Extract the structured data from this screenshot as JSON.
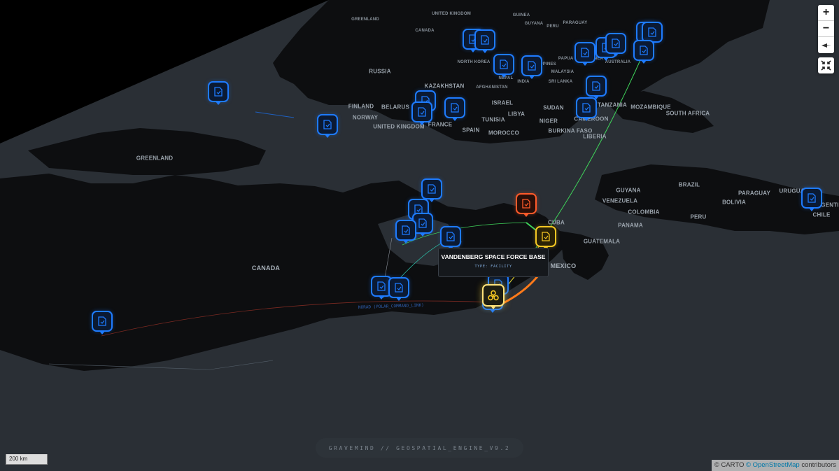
{
  "map": {
    "colors": {
      "sky": "#000000",
      "ocean": "#2a2f35",
      "land": "#0d0e10",
      "pin_blue": "#1e7bff",
      "pin_red": "#ff5a2a",
      "pin_yellow": "#f3c623",
      "route_orange": "#ff7a1a",
      "route_green": "#3fd25a"
    },
    "labels": [
      {
        "text": "GREENLAND",
        "size": "sm"
      },
      {
        "text": "UNITED KINGDOM",
        "size": "sm"
      },
      {
        "text": "GUINEA",
        "size": "sm"
      },
      {
        "text": "GUYANA",
        "size": "sm"
      },
      {
        "text": "PERU",
        "size": "sm"
      },
      {
        "text": "PARAGUAY",
        "size": "sm"
      },
      {
        "text": "CANADA",
        "size": "sm"
      },
      {
        "text": "PAPUA NEW GUINEA",
        "size": "sm"
      },
      {
        "text": "AUSTRALIA",
        "size": "sm"
      },
      {
        "text": "NORTH KOREA",
        "size": "sm"
      },
      {
        "text": "RUSSIA",
        "size": "md"
      },
      {
        "text": "NEPAL",
        "size": "sm"
      },
      {
        "text": "INDIA",
        "size": "sm"
      },
      {
        "text": "MALAYSIA",
        "size": "sm"
      },
      {
        "text": "SRI LANKA",
        "size": "sm"
      },
      {
        "text": "PHILIPPINES",
        "size": "sm"
      },
      {
        "text": "KAZAKHSTAN",
        "size": "md"
      },
      {
        "text": "AFGHANISTAN",
        "size": "sm"
      },
      {
        "text": "FINLAND",
        "size": "md"
      },
      {
        "text": "NORWAY",
        "size": "md"
      },
      {
        "text": "BELARUS",
        "size": "md"
      },
      {
        "text": "ISRAEL",
        "size": "md"
      },
      {
        "text": "LIBYA",
        "size": "md"
      },
      {
        "text": "SUDAN",
        "size": "md"
      },
      {
        "text": "TANZANIA",
        "size": "md"
      },
      {
        "text": "MOZAMBIQUE",
        "size": "md"
      },
      {
        "text": "SOUTH AFRICA",
        "size": "md"
      },
      {
        "text": "UNITED KINGDOM",
        "size": "md"
      },
      {
        "text": "FRANCE",
        "size": "md"
      },
      {
        "text": "TUNISIA",
        "size": "md"
      },
      {
        "text": "NIGER",
        "size": "md"
      },
      {
        "text": "CAMEROON",
        "size": "md"
      },
      {
        "text": "SPAIN",
        "size": "md"
      },
      {
        "text": "MOROCCO",
        "size": "md"
      },
      {
        "text": "BURKINA FASO",
        "size": "md"
      },
      {
        "text": "LIBERIA",
        "size": "md"
      },
      {
        "text": "GREENLAND",
        "size": "md"
      },
      {
        "text": "GUYANA",
        "size": "md"
      },
      {
        "text": "BRAZIL",
        "size": "md"
      },
      {
        "text": "VENEZUELA",
        "size": "md"
      },
      {
        "text": "PARAGUAY",
        "size": "md"
      },
      {
        "text": "URUGUAY",
        "size": "md"
      },
      {
        "text": "COLOMBIA",
        "size": "md"
      },
      {
        "text": "BOLIVIA",
        "size": "md"
      },
      {
        "text": "PERU",
        "size": "md"
      },
      {
        "text": "ARGENTINA",
        "size": "md"
      },
      {
        "text": "CHILE",
        "size": "md"
      },
      {
        "text": "PANAMA",
        "size": "md"
      },
      {
        "text": "CUBA",
        "size": "md"
      },
      {
        "text": "GUATEMALA",
        "size": "md"
      },
      {
        "text": "MEXICO",
        "size": "lg"
      },
      {
        "text": "CANADA",
        "size": "lg"
      }
    ],
    "route_label": "NORAD (POLAR_COMMAND_LINK)"
  },
  "markers": [
    {
      "type": "document",
      "status": "blue"
    },
    {
      "type": "document",
      "status": "blue"
    },
    {
      "type": "document",
      "status": "blue"
    },
    {
      "type": "document",
      "status": "blue"
    },
    {
      "type": "document",
      "status": "blue"
    },
    {
      "type": "document",
      "status": "blue"
    },
    {
      "type": "document",
      "status": "blue"
    },
    {
      "type": "document",
      "status": "blue"
    },
    {
      "type": "document",
      "status": "blue"
    },
    {
      "type": "document",
      "status": "blue"
    },
    {
      "type": "document",
      "status": "blue"
    },
    {
      "type": "document",
      "status": "blue"
    },
    {
      "type": "document",
      "status": "blue"
    },
    {
      "type": "document",
      "status": "blue"
    },
    {
      "type": "document",
      "status": "blue"
    },
    {
      "type": "document",
      "status": "blue"
    },
    {
      "type": "document",
      "status": "blue"
    },
    {
      "type": "document",
      "status": "blue"
    },
    {
      "type": "document",
      "status": "blue"
    },
    {
      "type": "document",
      "status": "blue"
    },
    {
      "type": "document",
      "status": "blue"
    },
    {
      "type": "document",
      "status": "blue"
    },
    {
      "type": "document",
      "status": "blue"
    },
    {
      "type": "document",
      "status": "blue"
    },
    {
      "type": "document",
      "status": "blue"
    },
    {
      "type": "document",
      "status": "blue"
    },
    {
      "type": "document",
      "status": "blue"
    },
    {
      "type": "document",
      "status": "blue"
    },
    {
      "type": "document",
      "status": "red"
    },
    {
      "type": "document",
      "status": "yellow"
    },
    {
      "type": "hazard",
      "status": "selected"
    }
  ],
  "tooltip": {
    "title": "VANDENBERG SPACE FORCE BASE",
    "subtitle": "TYPE: FACILITY"
  },
  "controls": {
    "zoom_in": "+",
    "zoom_out": "−",
    "reset_bearing_icon": "compass-icon",
    "fullscreen_icon": "collapse-icon"
  },
  "banner": "GRAVEMIND // GEOSPATIAL_ENGINE_V9.2",
  "scale": "200 km",
  "attribution": {
    "carto": "© CARTO",
    "osm": "© OpenStreetMap",
    "suffix": " contributors"
  }
}
